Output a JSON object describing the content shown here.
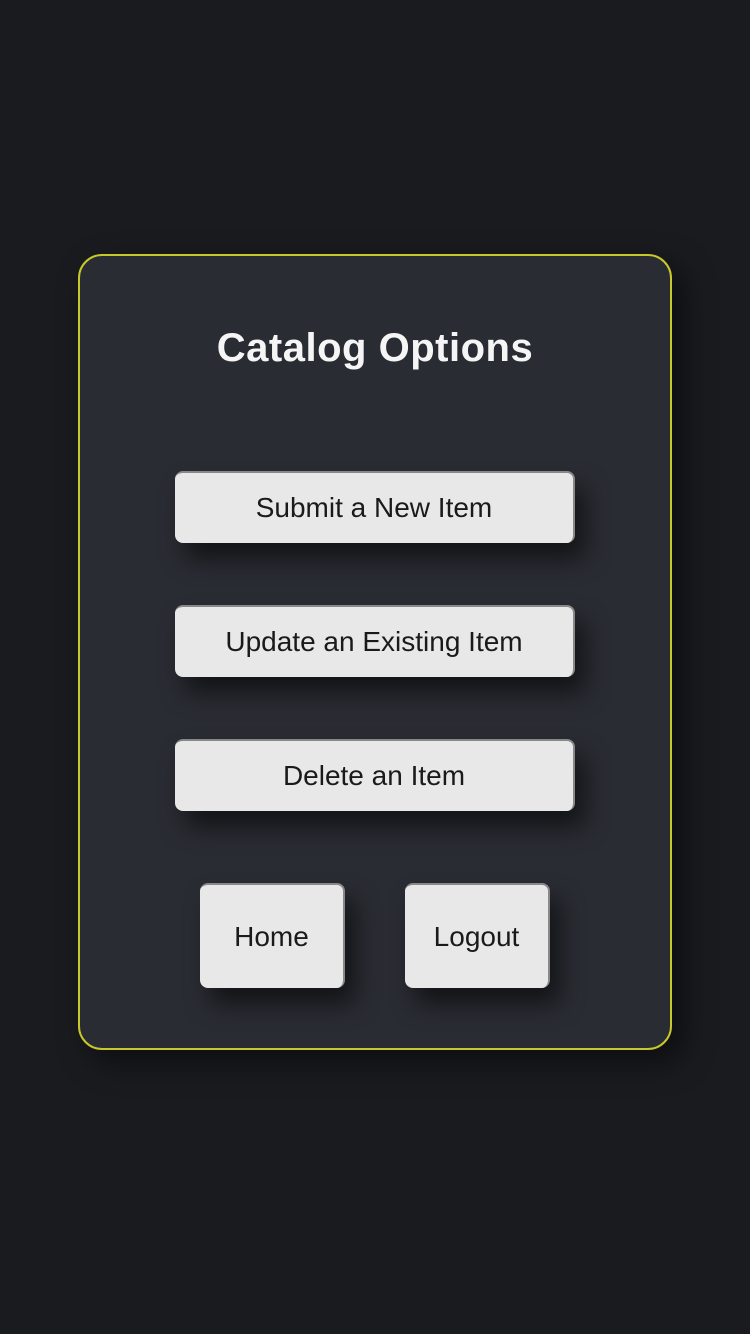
{
  "card": {
    "title": "Catalog Options",
    "buttons": {
      "submit": "Submit a New Item",
      "update": "Update an Existing Item",
      "delete": "Delete an Item",
      "home": "Home",
      "logout": "Logout"
    }
  },
  "colors": {
    "background": "#1a1b1f",
    "card_bg": "#2a2c33",
    "border": "#c8c82a",
    "button_bg": "#e8e8e8",
    "title_text": "#f5f5f5",
    "button_text": "#1a1a1a"
  }
}
